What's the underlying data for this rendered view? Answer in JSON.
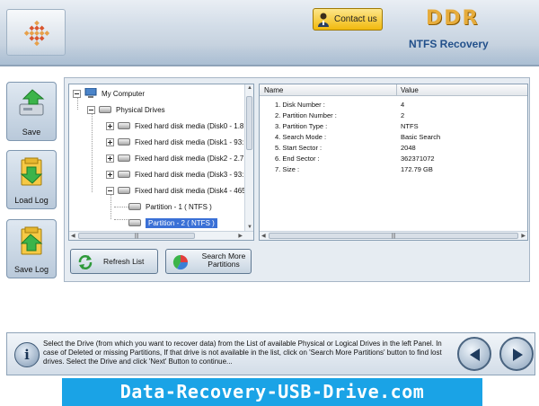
{
  "header": {
    "contact_label": "Contact us",
    "brand": "DDR",
    "product": "NTFS Recovery"
  },
  "sidebar": {
    "items": [
      {
        "label": "Save",
        "icon": "save-drive-icon"
      },
      {
        "label": "Load Log",
        "icon": "load-log-icon"
      },
      {
        "label": "Save Log",
        "icon": "save-log-icon"
      }
    ]
  },
  "tree": {
    "root": "My Computer",
    "physical": "Physical Drives",
    "disks": [
      "Fixed hard disk media (Disk0 - 1.8",
      "Fixed hard disk media (Disk1 - 93:",
      "Fixed hard disk media (Disk2 - 2.7",
      "Fixed hard disk media (Disk3 - 93:",
      "Fixed hard disk media (Disk4 - 465"
    ],
    "partitions": [
      "Partition - 1 ( NTFS )",
      "Partition - 2 ( NTFS )"
    ],
    "selected": "Partition - 2 ( NTFS )"
  },
  "grid": {
    "col_name": "Name",
    "col_value": "Value",
    "rows": [
      {
        "name": "1. Disk Number :",
        "value": "4"
      },
      {
        "name": "2. Partition Number :",
        "value": "2"
      },
      {
        "name": "3. Partition Type :",
        "value": "NTFS"
      },
      {
        "name": "4. Search Mode :",
        "value": "Basic Search"
      },
      {
        "name": "5. Start Sector :",
        "value": "2048"
      },
      {
        "name": "6. End Sector :",
        "value": "362371072"
      },
      {
        "name": "7. Size :",
        "value": "172.79 GB"
      }
    ]
  },
  "actions": {
    "refresh_label": "Refresh List",
    "search_more_line1": "Search More",
    "search_more_line2": "Partitions"
  },
  "footer": {
    "info_glyph": "i",
    "hint": "Select the Drive (from which you want to recover data) from the List of available Physical or Logical Drives in the left Panel. In case of Deleted or missing Partitions, If that drive is not available in the list, click on 'Search More Partitions' button to find lost drives. Select the Drive and click 'Next' Button to continue..."
  },
  "banner": "Data-Recovery-USB-Drive.com",
  "colors": {
    "accent_blue": "#1aa3e6",
    "selection": "#3a70d6",
    "contact_gold": "#f1b90e",
    "brand_orange": "#e6ac3c"
  }
}
